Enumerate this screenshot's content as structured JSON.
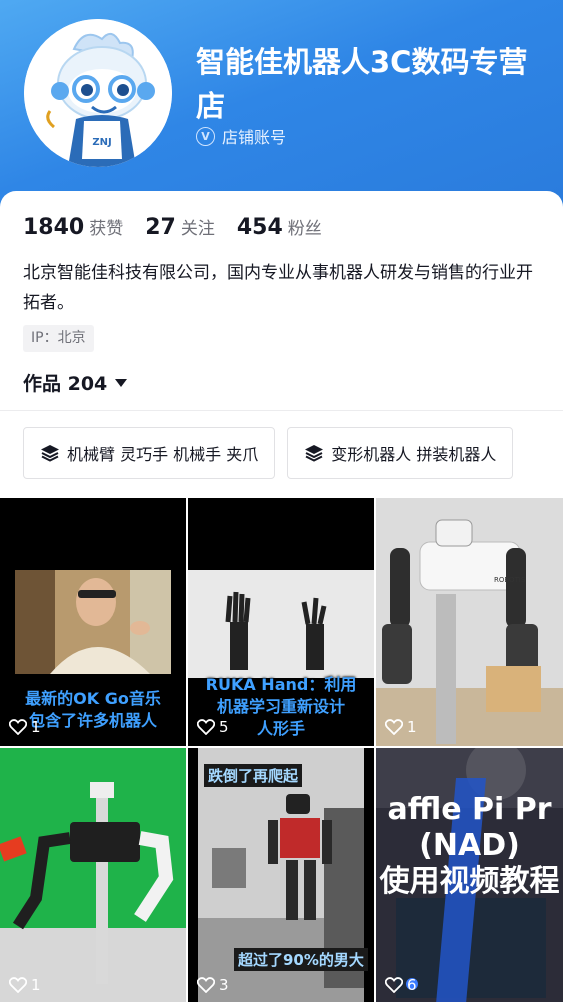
{
  "shop": {
    "name": "智能佳机器人3C数码专营店",
    "verify_label": "店铺账号",
    "avatar_badge": "ZNJ"
  },
  "stats": [
    {
      "value": "1840",
      "label": "获赞"
    },
    {
      "value": "27",
      "label": "关注"
    },
    {
      "value": "454",
      "label": "粉丝"
    }
  ],
  "bio": "北京智能佳科技有限公司，国内专业从事机器人研发与销售的行业开拓者。",
  "ip": "IP：北京",
  "works": {
    "label": "作品 204"
  },
  "collections": [
    {
      "label": "机械臂 灵巧手 机械手 夹爪",
      "icon": "layers-icon"
    },
    {
      "label": "变形机器人 拼装机器人",
      "icon": "layers-icon"
    }
  ],
  "videos": [
    {
      "likes": "1",
      "caption_line1": "最新的OK Go音乐",
      "caption_line2": "包含了许多机器人"
    },
    {
      "likes": "5",
      "caption_line1": "RUKA Hand：利用",
      "caption_line2": "机器学习重新设计",
      "caption_line3": "人形手"
    },
    {
      "likes": "1",
      "logo_text": "ROBOTIS"
    },
    {
      "likes": "1"
    },
    {
      "likes": "3",
      "top_tag": "跌倒了再爬起",
      "bottom_tag": "超过了90%的男大"
    },
    {
      "likes": "6",
      "title_line1": "affle Pi Pr",
      "title_line2": "(NAD)",
      "title_line3": "使用视频教程"
    }
  ],
  "colors": {
    "header": "#2f86e6",
    "caption": "#3fa0ff",
    "accent_tag": "#a4d8ff"
  }
}
